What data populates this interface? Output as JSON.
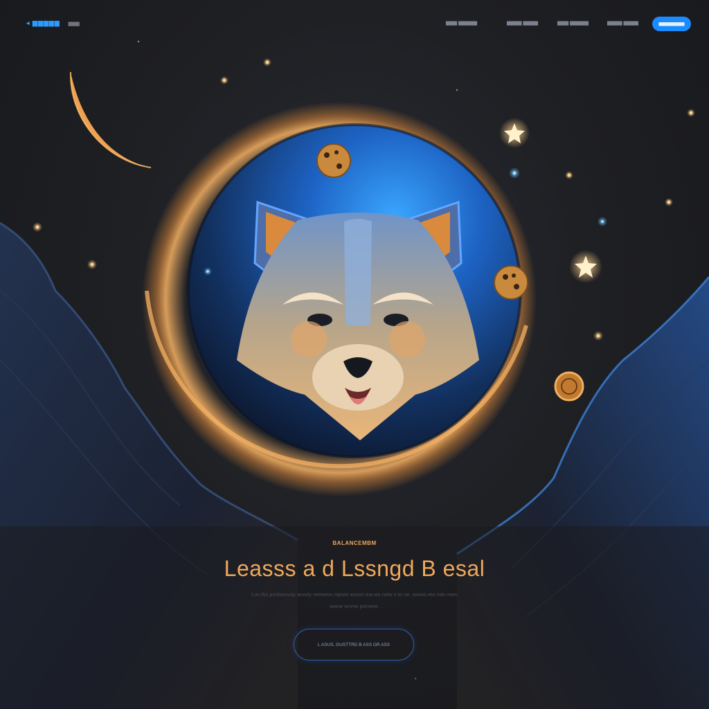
{
  "nav": {
    "logo_text": "◂ ▆▆▆▆▆",
    "logo_sub": "▆▆▆",
    "links": [
      "▆▆▆ ▆▆▆▆▆",
      "▆▆▆▆ ▆▆▆▆",
      "▆▆▆ ▆▆▆▆▆",
      "▆▆▆▆ ▆▆▆▆"
    ],
    "cta_label": "▆▆▆▆▆▆▆▆"
  },
  "hero": {
    "eyebrow": "BALANCEMBM",
    "headline": "Leasss a d Lssngd B esal",
    "description_line1": "Lus ths pnnlsesvsp avvsty neewmn nqneo wnnm ma wo neto n to ne, wwwo eto mto nwm",
    "description_line2": "wwne wnme pnnwne.",
    "button_label": "L ASUS, GUSTTRD B ASS GR ASS"
  },
  "colors": {
    "accent_blue": "#1b8cff",
    "accent_orange": "#f0a85c",
    "background": "#1c1c1e"
  },
  "icons": [
    "crescent-moon-icon",
    "star-icon",
    "cookie-icon",
    "coin-icon",
    "dog-mascot-icon"
  ]
}
